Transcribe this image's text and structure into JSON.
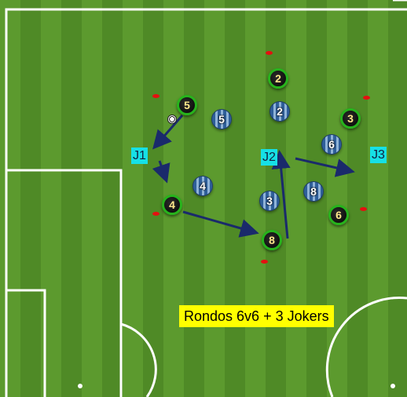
{
  "title": "Rondos 6v6 + 3 Jokers",
  "jokers": [
    "J1",
    "J2",
    "J3"
  ],
  "team_a_players": [
    "5",
    "2",
    "3",
    "4",
    "8",
    "6"
  ],
  "team_b_players": [
    "5",
    "2",
    "6",
    "4",
    "3",
    "8"
  ],
  "colors": {
    "team_a_shirt": "#111111",
    "team_a_ring": "#27b31c",
    "team_b_shirt": "#2f5f9a",
    "joker_box": "#16e0e6",
    "title_bg": "#ffff00",
    "arrow": "#1a2a6b",
    "cone": "#e41010"
  }
}
